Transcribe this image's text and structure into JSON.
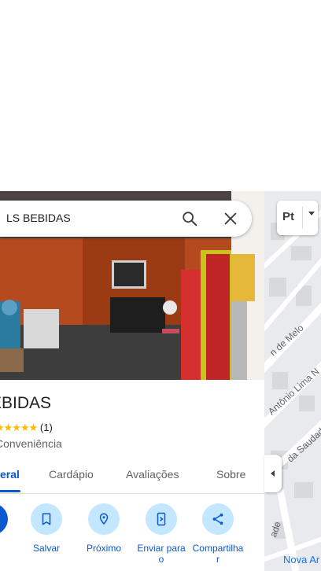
{
  "search": {
    "query": "LS BEBIDAS"
  },
  "place": {
    "name": "EBIDAS",
    "rating_count": "(1)",
    "category": "Conveniência"
  },
  "tabs": [
    {
      "label": "eral",
      "active": true
    },
    {
      "label": "Cardápio"
    },
    {
      "label": "Avaliações"
    },
    {
      "label": "Sobre"
    }
  ],
  "actions": [
    {
      "label": "s",
      "icon": "directions-icon"
    },
    {
      "label": "Salvar",
      "icon": "bookmark-icon"
    },
    {
      "label": "Próximo",
      "icon": "nearby-icon"
    },
    {
      "label": "Enviar para\no\n.",
      "icon": "send-to-phone-icon"
    },
    {
      "label": "Compartilha\nr",
      "icon": "share-icon"
    }
  ],
  "map": {
    "layer_button": "Pt",
    "streets": [
      "n de Melo",
      "Antônio Lima N",
      "da Saudad",
      "ade"
    ],
    "bottom_label": "Nova Ar"
  },
  "colors": {
    "accent": "#0b57d0",
    "action_bg": "#c2e7ff",
    "star": "#fbbc04"
  }
}
